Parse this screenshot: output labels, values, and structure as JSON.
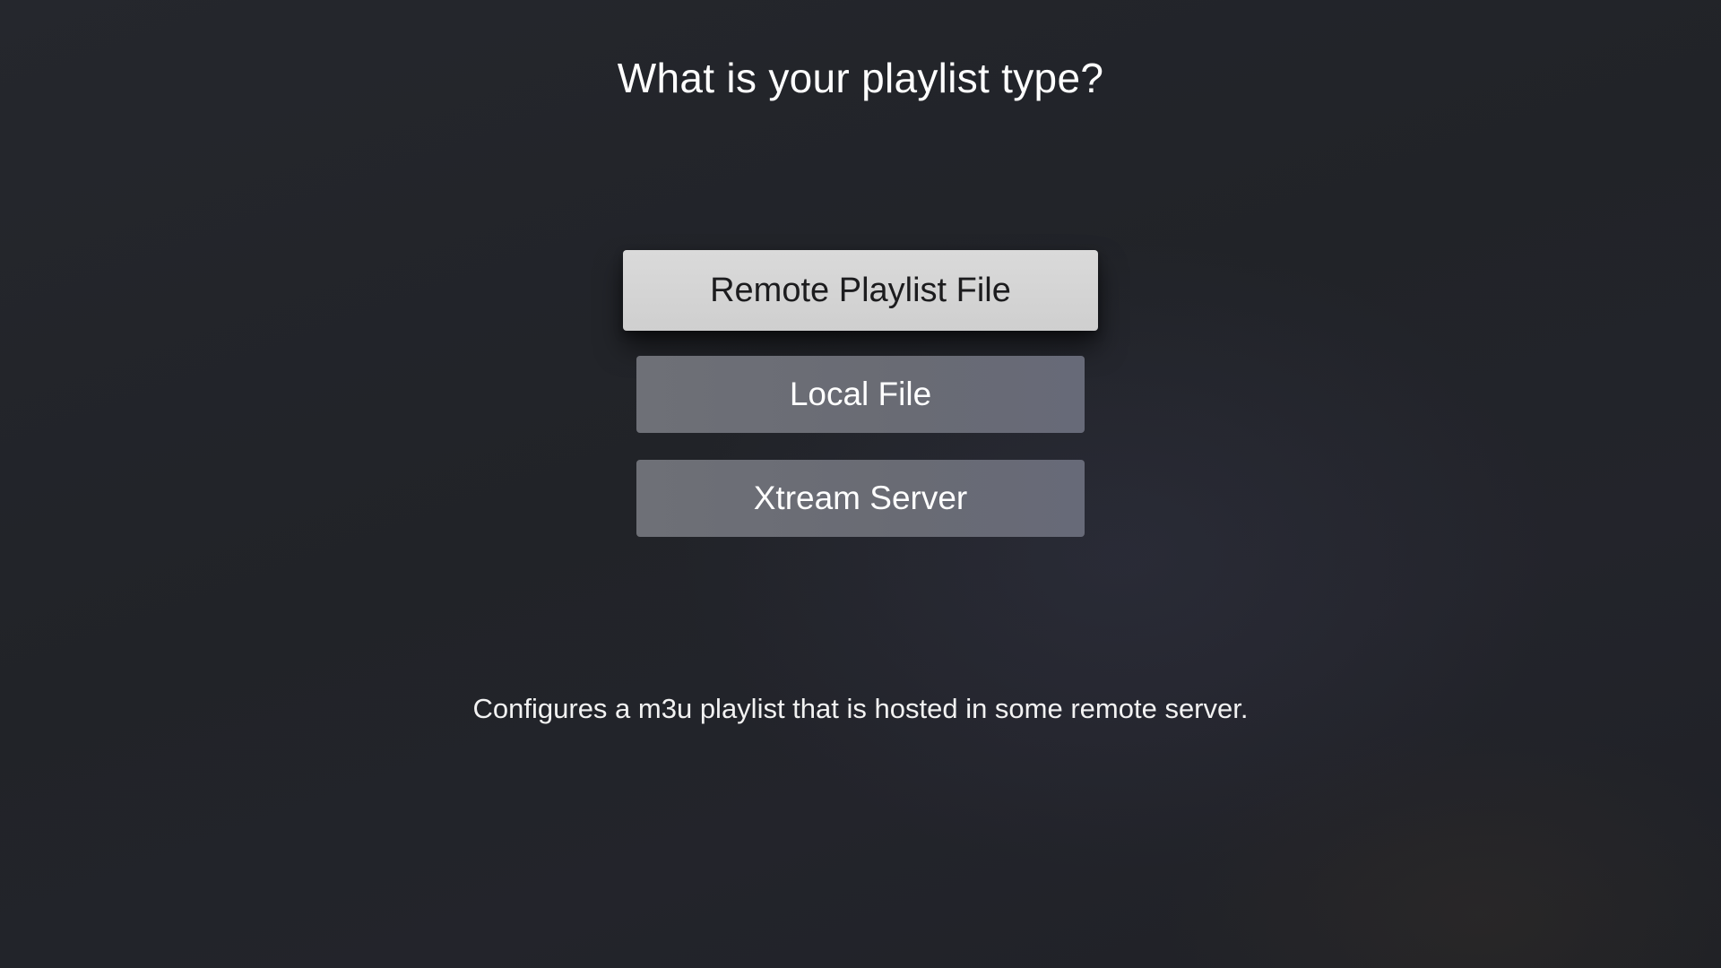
{
  "screen": {
    "title": "What is your playlist type?",
    "description": "Configures a m3u playlist that is hosted in some remote server."
  },
  "options": [
    {
      "label": "Remote Playlist File",
      "state": "focused"
    },
    {
      "label": "Local File",
      "state": "normal"
    },
    {
      "label": "Xtream Server",
      "state": "normal"
    }
  ],
  "colors": {
    "background": "#222429",
    "focused_button_bg": "#d4d4d4",
    "focused_button_text": "#1c1c1e",
    "button_bg": "#6c6e76",
    "text": "#ffffff"
  }
}
